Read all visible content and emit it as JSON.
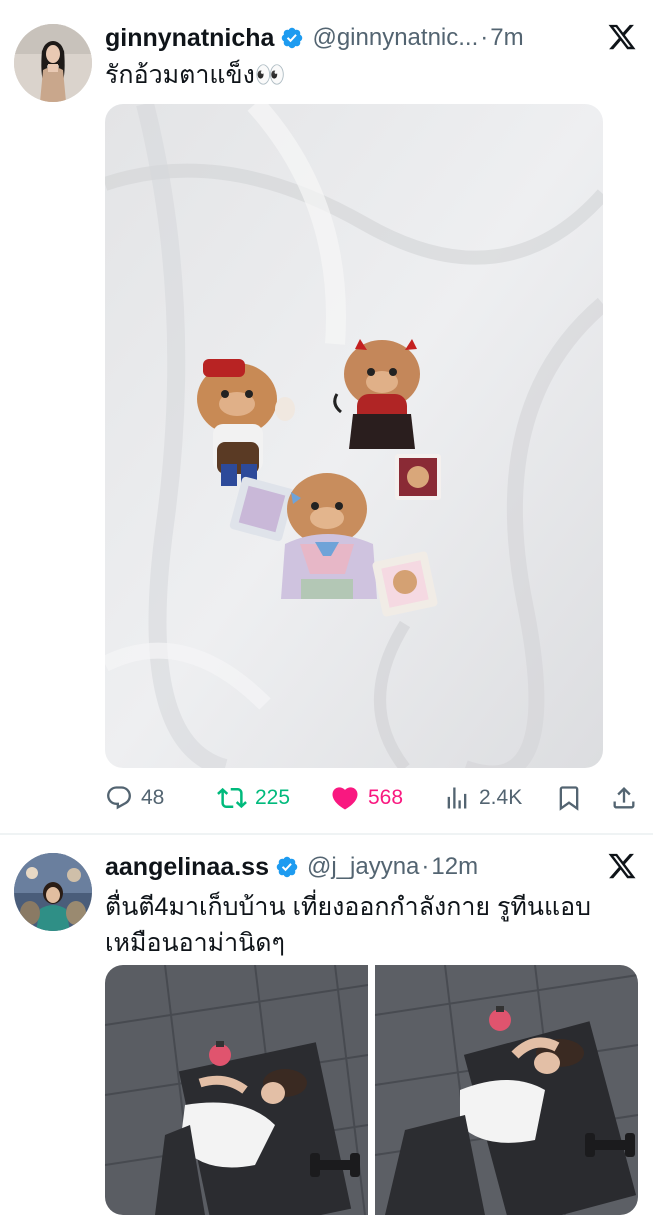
{
  "tweets": [
    {
      "display_name": "ginnynatnicha",
      "handle": "@ginnynatnic...",
      "separator": "·",
      "time": "7m",
      "text": "รักอ้วมตาแข็ง👀",
      "stats": {
        "replies": "48",
        "reposts": "225",
        "likes": "568",
        "views": "2.4K"
      },
      "liked": true
    },
    {
      "display_name": "aangelinaa.ss",
      "handle": "@j_jayyna",
      "separator": "·",
      "time": "12m",
      "text_line1": "ตื่นตี4มาเก็บบ้าน เที่ยงออกกำลังกาย รูทีนแอบ",
      "text_line2": "เหมือนอาม่านิดๆ"
    }
  ],
  "colors": {
    "verified": "#1d9bf0",
    "repost": "#00ba7c",
    "like": "#f91880",
    "muted": "#536471"
  },
  "icons": [
    "verified-badge-icon",
    "x-logo-icon",
    "reply-icon",
    "repost-icon",
    "like-icon",
    "views-icon",
    "bookmark-icon",
    "share-icon"
  ]
}
